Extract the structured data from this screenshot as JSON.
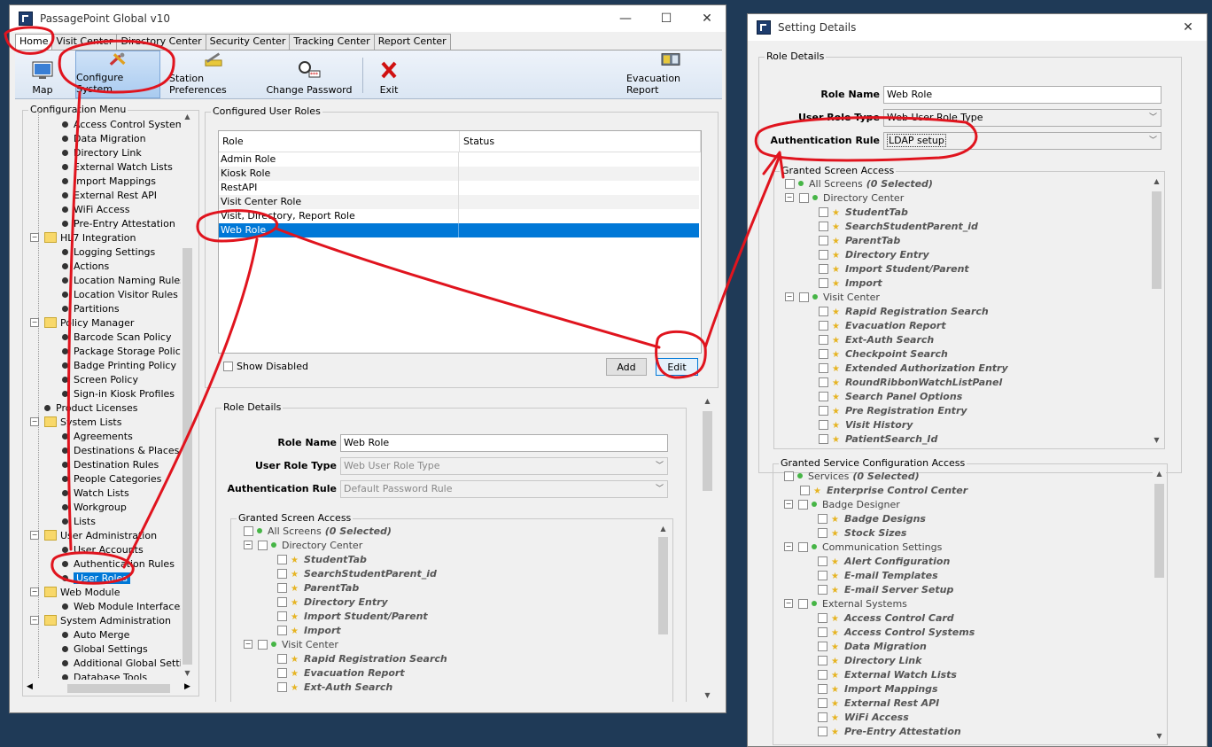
{
  "main_window": {
    "title": "PassagePoint Global v10",
    "controls": {
      "minimize": "—",
      "maximize": "☐",
      "close": "✕"
    },
    "tabs": [
      "Home",
      "Visit Center",
      "Directory Center",
      "Security Center",
      "Tracking Center",
      "Report Center"
    ],
    "toolbar": [
      {
        "label": "Map",
        "icon": "map-icon"
      },
      {
        "label": "Configure System",
        "icon": "tools-icon"
      },
      {
        "label": "Station Preferences",
        "icon": "wrench-icon"
      },
      {
        "label": "Change Password",
        "icon": "password-icon"
      },
      {
        "label": "Exit",
        "icon": "exit-icon"
      },
      {
        "label": "Evacuation Report",
        "icon": "evacuation-icon"
      }
    ],
    "config_menu": {
      "title": "Configuration Menu",
      "items": [
        {
          "label": "Access Control Systems",
          "level": 2
        },
        {
          "label": "Data Migration",
          "level": 2
        },
        {
          "label": "Directory Link",
          "level": 2
        },
        {
          "label": "External Watch Lists",
          "level": 2
        },
        {
          "label": "Import Mappings",
          "level": 2
        },
        {
          "label": "External Rest API",
          "level": 2
        },
        {
          "label": "WiFi Access",
          "level": 2
        },
        {
          "label": "Pre-Entry Attestation",
          "level": 2
        },
        {
          "label": "HL7 Integration",
          "level": 1
        },
        {
          "label": "Logging Settings",
          "level": 2
        },
        {
          "label": "Actions",
          "level": 2
        },
        {
          "label": "Location Naming Rules",
          "level": 2
        },
        {
          "label": "Location Visitor Rules",
          "level": 2
        },
        {
          "label": "Partitions",
          "level": 2
        },
        {
          "label": "Policy Manager",
          "level": 1
        },
        {
          "label": "Barcode Scan Policy",
          "level": 2
        },
        {
          "label": "Package Storage Policy",
          "level": 2
        },
        {
          "label": "Badge Printing Policy",
          "level": 2
        },
        {
          "label": "Screen Policy",
          "level": 2
        },
        {
          "label": "Sign-in Kiosk Profiles",
          "level": 2
        },
        {
          "label": "Product Licenses",
          "level": 1.5
        },
        {
          "label": "System Lists",
          "level": 1
        },
        {
          "label": "Agreements",
          "level": 2
        },
        {
          "label": "Destinations & Places",
          "level": 2
        },
        {
          "label": "Destination Rules",
          "level": 2
        },
        {
          "label": "People Categories",
          "level": 2
        },
        {
          "label": "Watch Lists",
          "level": 2
        },
        {
          "label": "Workgroup",
          "level": 2
        },
        {
          "label": "Lists",
          "level": 2
        },
        {
          "label": "User Administration",
          "level": 1
        },
        {
          "label": "User Accounts",
          "level": 2
        },
        {
          "label": "Authentication Rules",
          "level": 2
        },
        {
          "label": "User Roles",
          "level": 2,
          "selected": true
        },
        {
          "label": "Web Module",
          "level": 1
        },
        {
          "label": "Web Module Interfaces",
          "level": 2
        },
        {
          "label": "System Administration",
          "level": 1
        },
        {
          "label": "Auto Merge",
          "level": 2
        },
        {
          "label": "Global Settings",
          "level": 2
        },
        {
          "label": "Additional Global Setting",
          "level": 2
        },
        {
          "label": "Database Tools",
          "level": 2
        }
      ]
    },
    "configured_roles": {
      "title": "Configured User Roles",
      "columns": [
        "Role",
        "Status"
      ],
      "rows": [
        "Admin Role",
        "Kiosk Role",
        "RestAPI",
        "Visit Center Role",
        "Visit, Directory, Report Role",
        "Web Role"
      ],
      "selected_row": 5,
      "show_disabled_label": "Show Disabled",
      "add_label": "Add",
      "edit_label": "Edit"
    },
    "role_details": {
      "title": "Role Details",
      "role_name_label": "Role Name",
      "role_name_value": "Web Role",
      "user_role_type_label": "User Role Type",
      "user_role_type_value": "Web User Role Type",
      "auth_rule_label": "Authentication Rule",
      "auth_rule_value": "Default Password Rule",
      "granted_screen_access_title": "Granted Screen Access",
      "screens": [
        {
          "label": "All Screens",
          "extra": "(0 Selected)",
          "level": 0,
          "kind": "root"
        },
        {
          "label": "Directory Center",
          "level": 1,
          "kind": "group"
        },
        {
          "label": "StudentTab",
          "level": 2,
          "kind": "leaf"
        },
        {
          "label": "SearchStudentParent_id",
          "level": 2,
          "kind": "leaf"
        },
        {
          "label": "ParentTab",
          "level": 2,
          "kind": "leaf"
        },
        {
          "label": "Directory Entry",
          "level": 2,
          "kind": "leaf"
        },
        {
          "label": "Import Student/Parent",
          "level": 2,
          "kind": "leaf"
        },
        {
          "label": "Import",
          "level": 2,
          "kind": "leaf"
        },
        {
          "label": "Visit Center",
          "level": 1,
          "kind": "group"
        },
        {
          "label": "Rapid Registration Search",
          "level": 2,
          "kind": "leaf"
        },
        {
          "label": "Evacuation Report",
          "level": 2,
          "kind": "leaf"
        },
        {
          "label": "Ext-Auth Search",
          "level": 2,
          "kind": "leaf"
        }
      ]
    }
  },
  "setting_window": {
    "title": "Setting Details",
    "close": "✕",
    "role_details_title": "Role Details",
    "role_name_label": "Role Name",
    "role_name_value": "Web Role",
    "user_role_type_label": "User Role Type",
    "user_role_type_value": "Web User Role Type",
    "auth_rule_label": "Authentication Rule",
    "auth_rule_value": "LDAP setup",
    "granted_screen_access_title": "Granted Screen Access",
    "screens": [
      {
        "label": "All Screens",
        "extra": "(0 Selected)",
        "level": 0,
        "kind": "root"
      },
      {
        "label": "Directory Center",
        "level": 1,
        "kind": "group"
      },
      {
        "label": "StudentTab",
        "level": 2,
        "kind": "leaf"
      },
      {
        "label": "SearchStudentParent_id",
        "level": 2,
        "kind": "leaf"
      },
      {
        "label": "ParentTab",
        "level": 2,
        "kind": "leaf"
      },
      {
        "label": "Directory Entry",
        "level": 2,
        "kind": "leaf"
      },
      {
        "label": "Import Student/Parent",
        "level": 2,
        "kind": "leaf"
      },
      {
        "label": "Import",
        "level": 2,
        "kind": "leaf"
      },
      {
        "label": "Visit Center",
        "level": 1,
        "kind": "group"
      },
      {
        "label": "Rapid Registration Search",
        "level": 2,
        "kind": "leaf"
      },
      {
        "label": "Evacuation Report",
        "level": 2,
        "kind": "leaf"
      },
      {
        "label": "Ext-Auth Search",
        "level": 2,
        "kind": "leaf"
      },
      {
        "label": "Checkpoint Search",
        "level": 2,
        "kind": "leaf"
      },
      {
        "label": "Extended Authorization Entry",
        "level": 2,
        "kind": "leaf"
      },
      {
        "label": "RoundRibbonWatchListPanel",
        "level": 2,
        "kind": "leaf"
      },
      {
        "label": "Search Panel Options",
        "level": 2,
        "kind": "leaf"
      },
      {
        "label": "Pre Registration Entry",
        "level": 2,
        "kind": "leaf"
      },
      {
        "label": "Visit History",
        "level": 2,
        "kind": "leaf"
      },
      {
        "label": "PatientSearch_Id",
        "level": 2,
        "kind": "leaf"
      }
    ],
    "granted_service_title": "Granted Service Configuration Access",
    "services": [
      {
        "label": "Services",
        "extra": "(0 Selected)",
        "level": 0,
        "kind": "root"
      },
      {
        "label": "Enterprise Control Center",
        "level": 1,
        "kind": "leaf"
      },
      {
        "label": "Badge Designer",
        "level": 1,
        "kind": "group"
      },
      {
        "label": "Badge Designs",
        "level": 2,
        "kind": "leaf"
      },
      {
        "label": "Stock Sizes",
        "level": 2,
        "kind": "leaf"
      },
      {
        "label": "Communication Settings",
        "level": 1,
        "kind": "group"
      },
      {
        "label": "Alert Configuration",
        "level": 2,
        "kind": "leaf"
      },
      {
        "label": "E-mail Templates",
        "level": 2,
        "kind": "leaf"
      },
      {
        "label": "E-mail Server Setup",
        "level": 2,
        "kind": "leaf"
      },
      {
        "label": "External Systems",
        "level": 1,
        "kind": "group"
      },
      {
        "label": "Access Control Card",
        "level": 2,
        "kind": "leaf"
      },
      {
        "label": "Access Control Systems",
        "level": 2,
        "kind": "leaf"
      },
      {
        "label": "Data Migration",
        "level": 2,
        "kind": "leaf"
      },
      {
        "label": "Directory Link",
        "level": 2,
        "kind": "leaf"
      },
      {
        "label": "External Watch Lists",
        "level": 2,
        "kind": "leaf"
      },
      {
        "label": "Import Mappings",
        "level": 2,
        "kind": "leaf"
      },
      {
        "label": "External Rest API",
        "level": 2,
        "kind": "leaf"
      },
      {
        "label": "WiFi Access",
        "level": 2,
        "kind": "leaf"
      },
      {
        "label": "Pre-Entry Attestation",
        "level": 2,
        "kind": "leaf"
      }
    ]
  },
  "colors": {
    "selection": "#0078d7",
    "annotation": "#e0141e",
    "desktop": "#1f3a57"
  }
}
